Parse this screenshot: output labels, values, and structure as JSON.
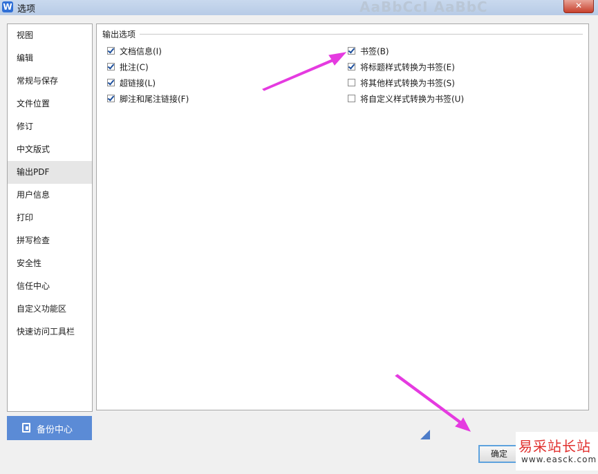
{
  "window": {
    "title": "选项",
    "app_icon": "W",
    "close_label": "✕",
    "bg_ribbon_text": "AaBbCcI AaBbC"
  },
  "sidebar": {
    "items": [
      {
        "label": "视图"
      },
      {
        "label": "编辑"
      },
      {
        "label": "常规与保存"
      },
      {
        "label": "文件位置"
      },
      {
        "label": "修订"
      },
      {
        "label": "中文版式"
      },
      {
        "label": "输出PDF",
        "active": true
      },
      {
        "label": "用户信息"
      },
      {
        "label": "打印"
      },
      {
        "label": "拼写检查"
      },
      {
        "label": "安全性"
      },
      {
        "label": "信任中心"
      },
      {
        "label": "自定义功能区"
      },
      {
        "label": "快速访问工具栏"
      }
    ],
    "backup_button": "备份中心"
  },
  "panel": {
    "group_title": "输出选项",
    "left_options": [
      {
        "label": "文档信息(I)",
        "checked": true
      },
      {
        "label": "批注(C)",
        "checked": true
      },
      {
        "label": "超链接(L)",
        "checked": true
      },
      {
        "label": "脚注和尾注链接(F)",
        "checked": true
      }
    ],
    "right_options": [
      {
        "label": "书签(B)",
        "checked": true
      },
      {
        "label": "将标题样式转换为书签(E)",
        "checked": true
      },
      {
        "label": "将其他样式转换为书签(S)",
        "checked": false
      },
      {
        "label": "将自定义样式转换为书签(U)",
        "checked": false
      }
    ]
  },
  "footer": {
    "ok_button": "确定"
  },
  "watermark": {
    "cn": "易采站长站",
    "url": "www.easck.com"
  },
  "colors": {
    "accent": "#5b8bd6",
    "annotation_arrow": "#e53be0"
  }
}
